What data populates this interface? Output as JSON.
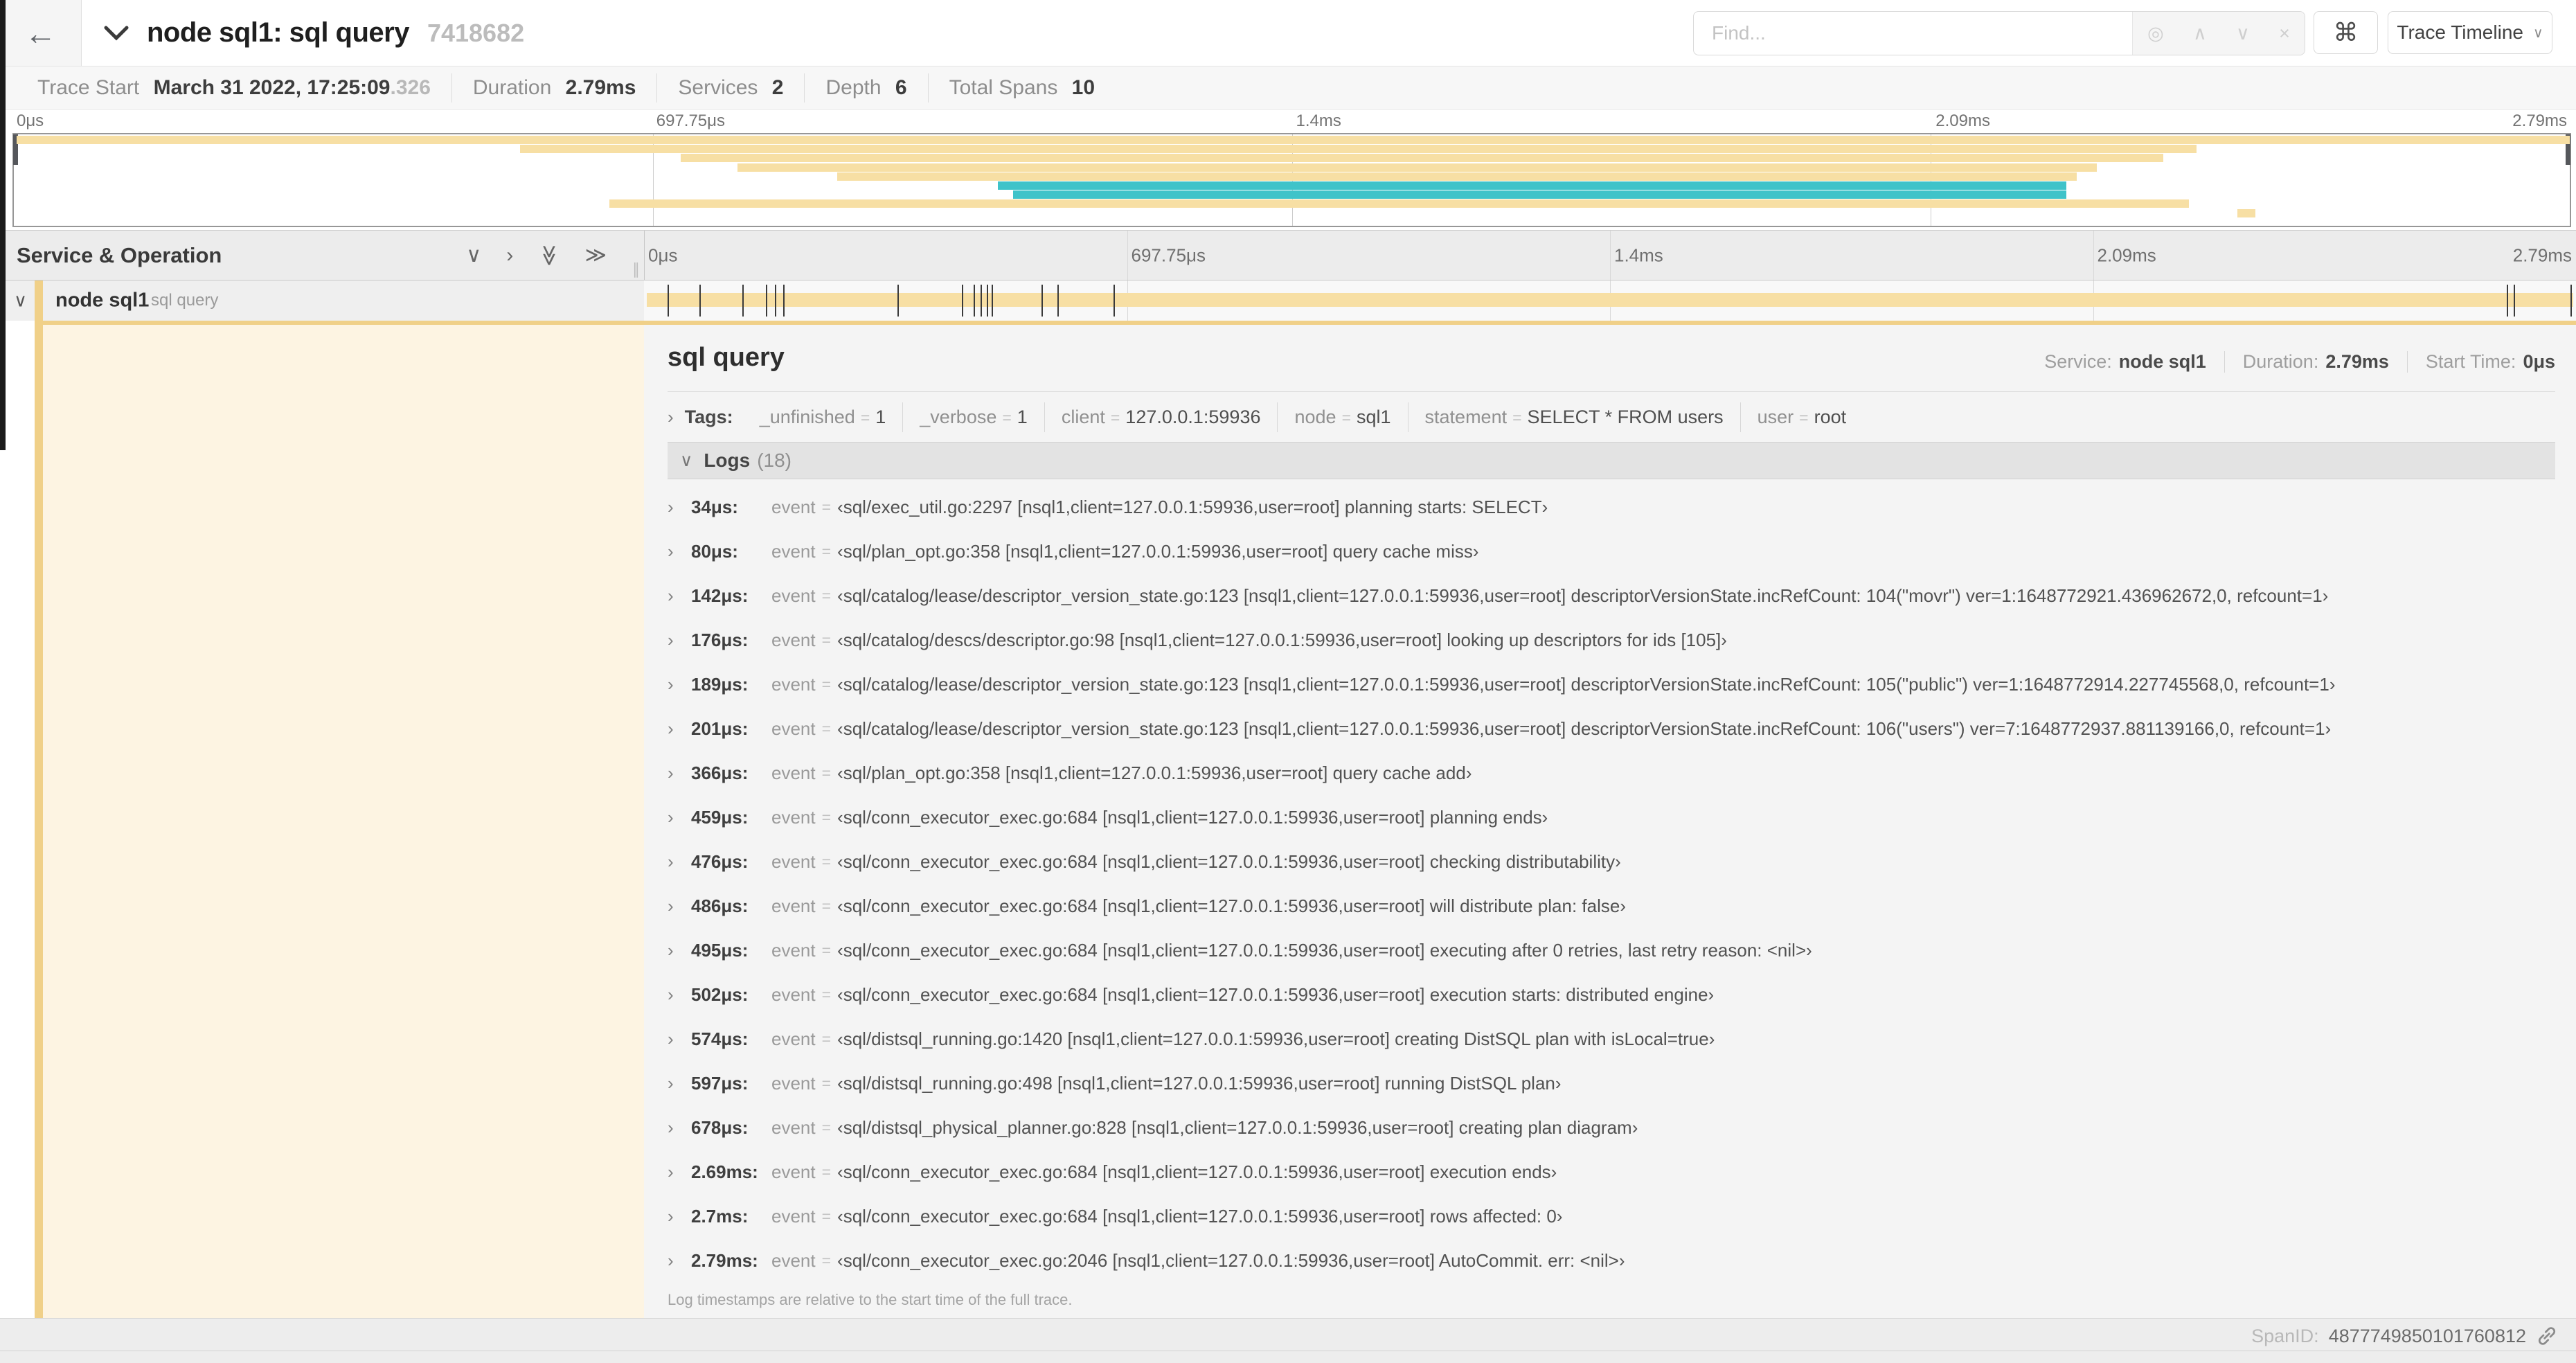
{
  "header": {
    "back_icon": "←",
    "title": "node sql1: sql query",
    "trace_id": "7418682",
    "find_placeholder": "Find...",
    "find_ops": [
      "◎",
      "∧",
      "∨",
      "×"
    ],
    "shortcut_icon": "⌘",
    "view_label": "Trace Timeline",
    "view_caret": "∨"
  },
  "summary": {
    "items": [
      {
        "label": "Trace Start",
        "value": "March 31 2022, 17:25:09",
        "suffix": ".326"
      },
      {
        "label": "Duration",
        "value": "2.79ms"
      },
      {
        "label": "Services",
        "value": "2"
      },
      {
        "label": "Depth",
        "value": "6"
      },
      {
        "label": "Total Spans",
        "value": "10"
      }
    ]
  },
  "minimap": {
    "bars": [
      {
        "row": 0,
        "start": 0.001,
        "end": 1.0,
        "color": "beige"
      },
      {
        "row": 1,
        "start": 0.198,
        "end": 0.854,
        "color": "beige"
      },
      {
        "row": 2,
        "start": 0.261,
        "end": 0.841,
        "color": "beige"
      },
      {
        "row": 3,
        "start": 0.283,
        "end": 0.815,
        "color": "beige"
      },
      {
        "row": 4,
        "start": 0.322,
        "end": 0.807,
        "color": "beige"
      },
      {
        "row": 5,
        "start": 0.385,
        "end": 0.803,
        "color": "teal"
      },
      {
        "row": 6,
        "start": 0.391,
        "end": 0.803,
        "color": "teal"
      },
      {
        "row": 7,
        "start": 0.233,
        "end": 0.851,
        "color": "beige"
      },
      {
        "row": 8,
        "start": 0.87,
        "end": 0.877,
        "color": "beige"
      }
    ]
  },
  "timeline": {
    "left_header": "Service & Operation",
    "collapse_icons": [
      "∨",
      "›",
      "≫",
      "≫"
    ],
    "resizer_icon": "∥",
    "ticks": [
      {
        "label": "0μs",
        "pos": 0
      },
      {
        "label": "697.75μs",
        "pos": 25
      },
      {
        "label": "1.4ms",
        "pos": 50
      },
      {
        "label": "2.09ms",
        "pos": 75
      },
      {
        "label": "2.79ms",
        "pos": 100
      }
    ],
    "span": {
      "service": "node sql1",
      "operation": "sql query",
      "chevron": "∨"
    },
    "event_marks_us": [
      34,
      80,
      142,
      176,
      189,
      201,
      366,
      459,
      476,
      486,
      495,
      502,
      574,
      597,
      678,
      2690,
      2700,
      2790
    ]
  },
  "detail": {
    "title": "sql query",
    "meta": [
      {
        "label": "Service:",
        "value": "node sql1"
      },
      {
        "label": "Duration:",
        "value": "2.79ms"
      },
      {
        "label": "Start Time:",
        "value": "0μs"
      }
    ],
    "tags": {
      "chevron": "›",
      "label": "Tags:",
      "items": [
        {
          "key": "_unfinished",
          "value": "1"
        },
        {
          "key": "_verbose",
          "value": "1"
        },
        {
          "key": "client",
          "value": "127.0.0.1:59936"
        },
        {
          "key": "node",
          "value": "sql1"
        },
        {
          "key": "statement",
          "value": "SELECT * FROM users"
        },
        {
          "key": "user",
          "value": "root"
        }
      ]
    },
    "logs": {
      "chevron": "∨",
      "label": "Logs",
      "count": "(18)",
      "row_chevron": "›",
      "rows": [
        {
          "time": "34μs:",
          "key": "event",
          "value": "‹sql/exec_util.go:2297 [nsql1,client=127.0.0.1:59936,user=root] planning starts: SELECT›"
        },
        {
          "time": "80μs:",
          "key": "event",
          "value": "‹sql/plan_opt.go:358 [nsql1,client=127.0.0.1:59936,user=root] query cache miss›"
        },
        {
          "time": "142μs:",
          "key": "event",
          "value": "‹sql/catalog/lease/descriptor_version_state.go:123 [nsql1,client=127.0.0.1:59936,user=root] descriptorVersionState.incRefCount: 104(\"movr\") ver=1:1648772921.436962672,0, refcount=1›"
        },
        {
          "time": "176μs:",
          "key": "event",
          "value": "‹sql/catalog/descs/descriptor.go:98 [nsql1,client=127.0.0.1:59936,user=root] looking up descriptors for ids [105]›"
        },
        {
          "time": "189μs:",
          "key": "event",
          "value": "‹sql/catalog/lease/descriptor_version_state.go:123 [nsql1,client=127.0.0.1:59936,user=root] descriptorVersionState.incRefCount: 105(\"public\") ver=1:1648772914.227745568,0, refcount=1›"
        },
        {
          "time": "201μs:",
          "key": "event",
          "value": "‹sql/catalog/lease/descriptor_version_state.go:123 [nsql1,client=127.0.0.1:59936,user=root] descriptorVersionState.incRefCount: 106(\"users\") ver=7:1648772937.881139166,0, refcount=1›"
        },
        {
          "time": "366μs:",
          "key": "event",
          "value": "‹sql/plan_opt.go:358 [nsql1,client=127.0.0.1:59936,user=root] query cache add›"
        },
        {
          "time": "459μs:",
          "key": "event",
          "value": "‹sql/conn_executor_exec.go:684 [nsql1,client=127.0.0.1:59936,user=root] planning ends›"
        },
        {
          "time": "476μs:",
          "key": "event",
          "value": "‹sql/conn_executor_exec.go:684 [nsql1,client=127.0.0.1:59936,user=root] checking distributability›"
        },
        {
          "time": "486μs:",
          "key": "event",
          "value": "‹sql/conn_executor_exec.go:684 [nsql1,client=127.0.0.1:59936,user=root] will distribute plan: false›"
        },
        {
          "time": "495μs:",
          "key": "event",
          "value": "‹sql/conn_executor_exec.go:684 [nsql1,client=127.0.0.1:59936,user=root] executing after 0 retries, last retry reason: <nil>›"
        },
        {
          "time": "502μs:",
          "key": "event",
          "value": "‹sql/conn_executor_exec.go:684 [nsql1,client=127.0.0.1:59936,user=root] execution starts: distributed engine›"
        },
        {
          "time": "574μs:",
          "key": "event",
          "value": "‹sql/distsql_running.go:1420 [nsql1,client=127.0.0.1:59936,user=root] creating DistSQL plan with isLocal=true›"
        },
        {
          "time": "597μs:",
          "key": "event",
          "value": "‹sql/distsql_running.go:498 [nsql1,client=127.0.0.1:59936,user=root] running DistSQL plan›"
        },
        {
          "time": "678μs:",
          "key": "event",
          "value": "‹sql/distsql_physical_planner.go:828 [nsql1,client=127.0.0.1:59936,user=root] creating plan diagram›"
        },
        {
          "time": "2.69ms:",
          "key": "event",
          "value": "‹sql/conn_executor_exec.go:684 [nsql1,client=127.0.0.1:59936,user=root] execution ends›"
        },
        {
          "time": "2.7ms:",
          "key": "event",
          "value": "‹sql/conn_executor_exec.go:684 [nsql1,client=127.0.0.1:59936,user=root] rows affected: 0›"
        },
        {
          "time": "2.79ms:",
          "key": "event",
          "value": "‹sql/conn_executor_exec.go:2046 [nsql1,client=127.0.0.1:59936,user=root] AutoCommit. err: <nil>›"
        }
      ],
      "footnote": "Log timestamps are relative to the start time of the full trace."
    },
    "span_id_label": "SpanID:",
    "span_id": "4877749850101760812"
  },
  "colors": {
    "beige": "#f7dfa4",
    "beige_strong": "#f0d088",
    "teal": "#3fc3c9",
    "cream": "#fdf4e2"
  }
}
